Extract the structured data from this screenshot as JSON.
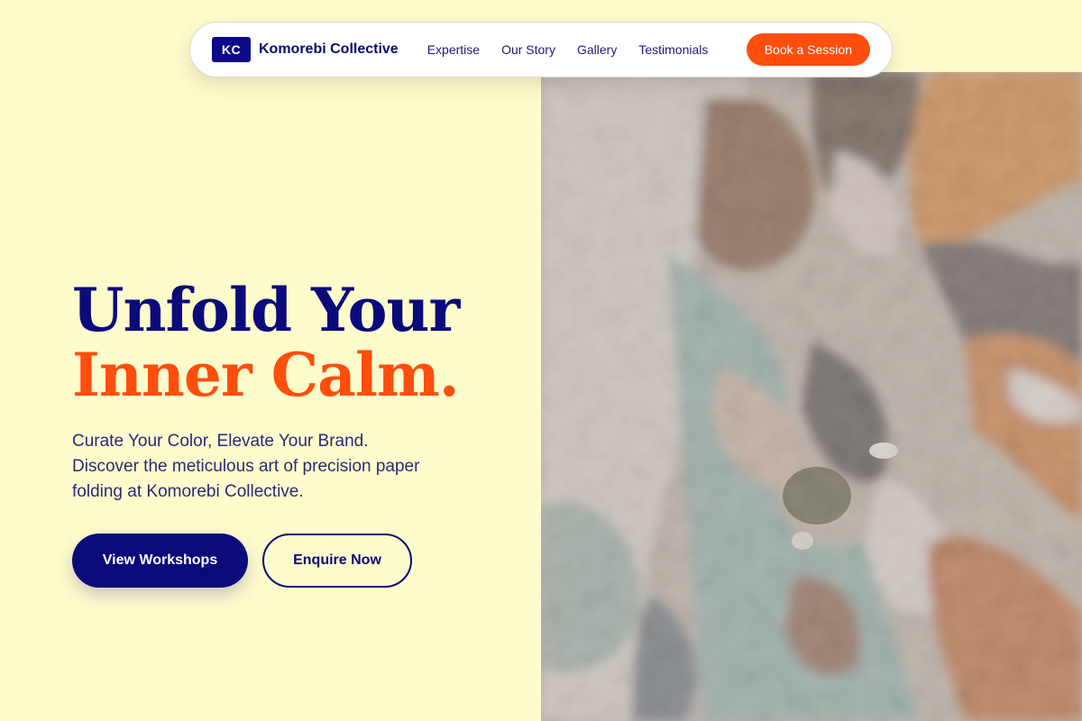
{
  "nav": {
    "logo_initials": "KC",
    "brand_name": "Komorebi Collective",
    "links": [
      "Expertise",
      "Our Story",
      "Gallery",
      "Testimonials"
    ],
    "cta_label": "Book a Session"
  },
  "hero": {
    "headline_line1": "Unfold Your",
    "headline_line2": "Inner Calm.",
    "subtitle_lines": [
      "Curate Your Color, Elevate Your Brand.",
      "Discover the meticulous art of precision paper",
      "folding at Komorebi Collective."
    ],
    "primary_button": "View Workshops",
    "secondary_button": "Enquire Now",
    "image_icon": "abstract-paint-texture"
  },
  "colors": {
    "background": "#fefccc",
    "navy": "#0b0a7a",
    "accent_orange": "#ff4e0e"
  }
}
